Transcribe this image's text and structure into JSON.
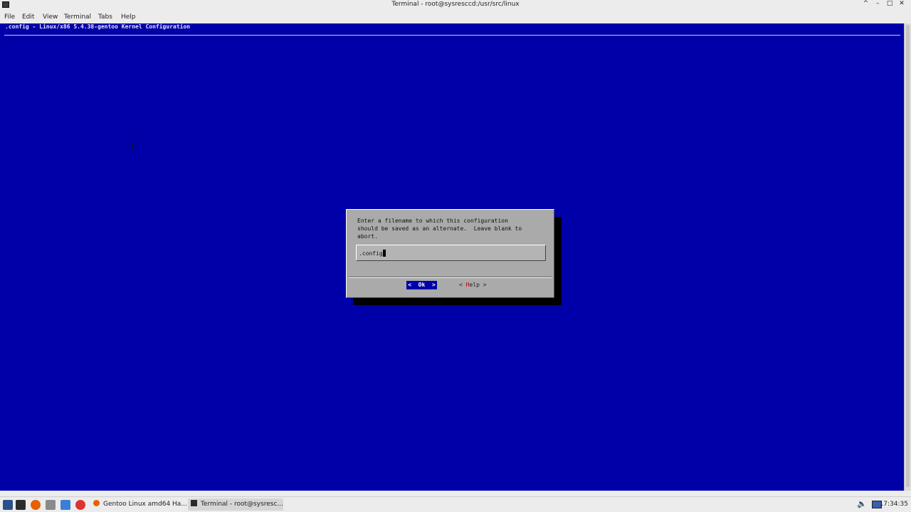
{
  "window": {
    "title": "Terminal - root@sysresccd:/usr/src/linux",
    "controls": [
      "^",
      "–",
      "□",
      "✕"
    ]
  },
  "menu": [
    "File",
    "Edit",
    "View",
    "Terminal",
    "Tabs",
    "Help"
  ],
  "terminal": {
    "header": ".config - Linux/x86 5.4.38-gentoo Kernel Configuration",
    "pointer": "I"
  },
  "dialog": {
    "message_lines": [
      "Enter a filename to which this configuration",
      "should be saved as an alternate.  Leave blank to",
      "abort."
    ],
    "input_value": ".config",
    "ok_label": "<  Ok  >",
    "help_prefix": "< ",
    "help_hot": "H",
    "help_rest": "elp >"
  },
  "taskbar": {
    "tasks": [
      "Gentoo Linux amd64 Ha...",
      "Terminal - root@sysresc..."
    ],
    "clock": "17:34:35"
  },
  "colors": {
    "terminal_bg": "#0000a8",
    "dialog_bg": "#aaaaaa",
    "selected_button": "#0000a8",
    "hotkey": "#b00000"
  }
}
